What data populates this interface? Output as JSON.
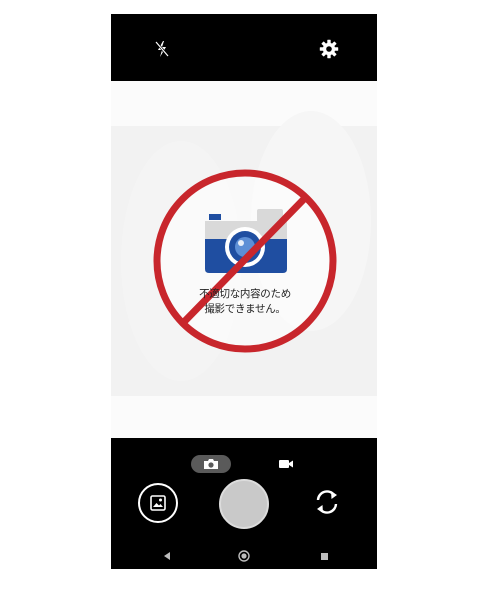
{
  "warning": {
    "line1": "不適切な内容のため",
    "line2": "撮影できません。"
  },
  "colors": {
    "prohibition_red": "#c8262c",
    "camera_blue": "#1f4ea1",
    "camera_grey": "#d9d9d9",
    "bar_black": "#000000"
  },
  "icons": {
    "flash": "flash-off-icon",
    "settings": "gear-icon",
    "photo_mode": "camera-icon",
    "video_mode": "video-camera-icon",
    "gallery": "image-icon",
    "switch_camera": "switch-camera-icon",
    "back": "back-triangle-icon",
    "home": "home-circle-icon",
    "recents": "recents-square-icon"
  }
}
